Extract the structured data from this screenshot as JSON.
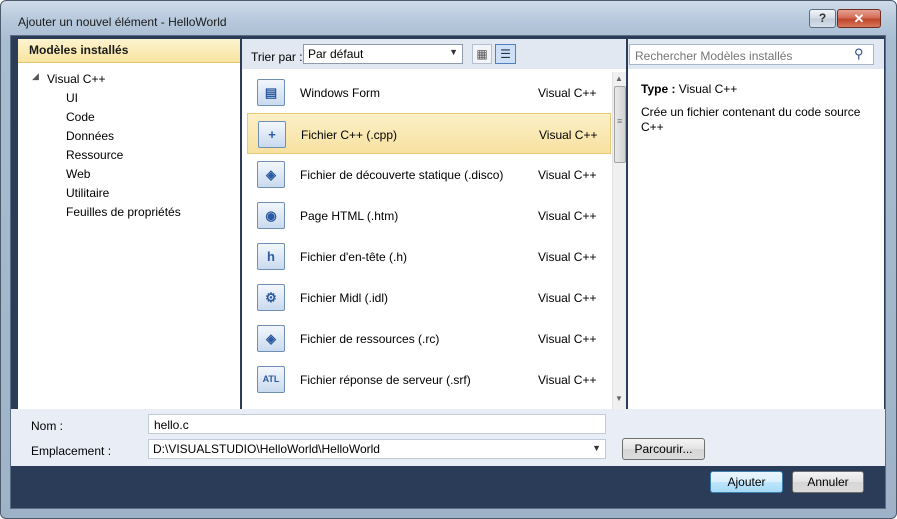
{
  "window": {
    "title": "Ajouter un nouvel élément - HelloWorld",
    "help_label": "?",
    "close_label": "✕"
  },
  "left_panel": {
    "header": "Modèles installés",
    "tree_root": "Visual C++",
    "tree_children": [
      "UI",
      "Code",
      "Données",
      "Ressource",
      "Web",
      "Utilitaire",
      "Feuilles de propriétés"
    ]
  },
  "toolbar": {
    "sort_label": "Trier par :",
    "sort_value": "Par défaut"
  },
  "items": [
    {
      "name": "Windows Form",
      "type": "Visual C++",
      "icon": "windows-form-icon",
      "glyph": "▤",
      "selected": false
    },
    {
      "name": "Fichier C++ (.cpp)",
      "type": "Visual C++",
      "icon": "cpp-file-icon",
      "glyph": "+",
      "selected": true
    },
    {
      "name": "Fichier de découverte statique (.disco)",
      "type": "Visual C++",
      "icon": "disco-file-icon",
      "glyph": "◈",
      "selected": false
    },
    {
      "name": "Page HTML (.htm)",
      "type": "Visual C++",
      "icon": "html-page-icon",
      "glyph": "◉",
      "selected": false
    },
    {
      "name": "Fichier d'en-tête (.h)",
      "type": "Visual C++",
      "icon": "header-file-icon",
      "glyph": "h",
      "selected": false
    },
    {
      "name": "Fichier Midl (.idl)",
      "type": "Visual C++",
      "icon": "midl-file-icon",
      "glyph": "⚙",
      "selected": false
    },
    {
      "name": "Fichier de ressources (.rc)",
      "type": "Visual C++",
      "icon": "resource-file-icon",
      "glyph": "◈",
      "selected": false
    },
    {
      "name": "Fichier réponse de serveur (.srf)",
      "type": "Visual C++",
      "icon": "srf-file-icon",
      "glyph": "ATL",
      "selected": false
    }
  ],
  "search": {
    "placeholder": "Rechercher Modèles installés"
  },
  "description": {
    "type_label": "Type :",
    "type_value": "Visual C++",
    "text": "Crée un fichier contenant du code source C++"
  },
  "form": {
    "name_label": "Nom :",
    "name_value": "hello.c",
    "location_label": "Emplacement :",
    "location_value": "D:\\VISUALSTUDIO\\HelloWorld\\HelloWorld",
    "browse_label": "Parcourir..."
  },
  "buttons": {
    "add_label": "Ajouter",
    "cancel_label": "Annuler"
  },
  "colors": {
    "selection": "#f7e1a0",
    "frame": "#2b3c59",
    "header": "#f7e49f"
  }
}
